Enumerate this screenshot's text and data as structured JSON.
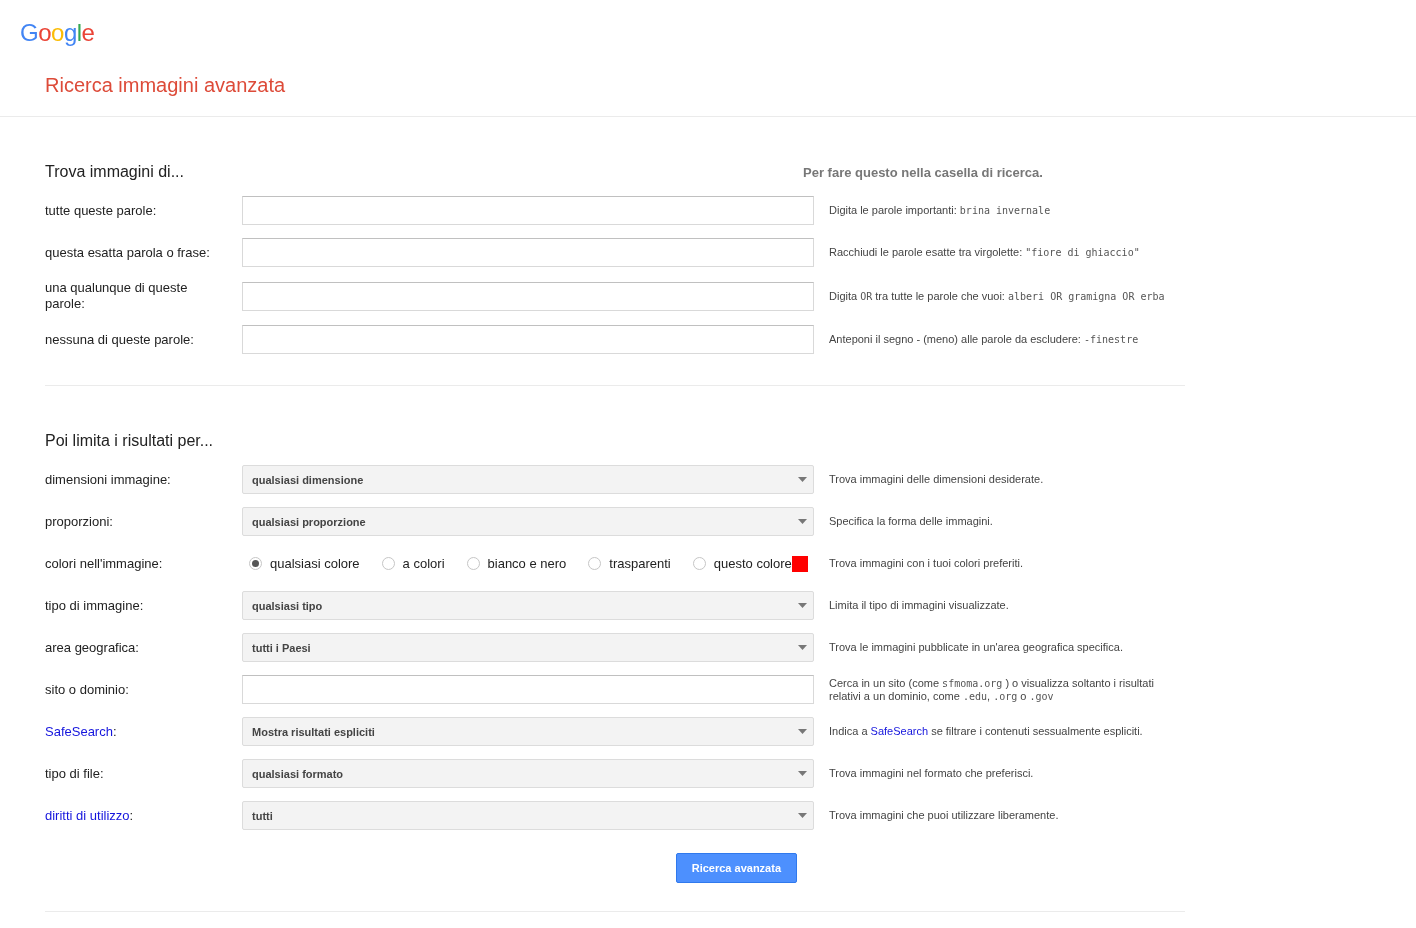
{
  "header": {
    "logo": "Google",
    "title": "Ricerca immagini avanzata"
  },
  "sections": [
    {
      "heading": "Trova immagini di...",
      "aside_heading": "Per fare questo nella casella di ricerca.",
      "rows": [
        {
          "kind": "text",
          "label": [
            {
              "kind": "plain",
              "text": "tutte queste parole:"
            }
          ],
          "value": "",
          "hint": [
            {
              "kind": "plain",
              "text": "Digita le parole importanti: "
            },
            {
              "kind": "code",
              "text": "brina invernale"
            }
          ]
        },
        {
          "kind": "text",
          "label": [
            {
              "kind": "plain",
              "text": "questa esatta parola o frase:"
            }
          ],
          "value": "",
          "hint": [
            {
              "kind": "plain",
              "text": "Racchiudi le parole esatte tra virgolette: "
            },
            {
              "kind": "code",
              "text": "\"fiore di ghiaccio\""
            }
          ]
        },
        {
          "kind": "text",
          "label": [
            {
              "kind": "plain",
              "text": "una qualunque di queste parole:"
            }
          ],
          "value": "",
          "hint": [
            {
              "kind": "plain",
              "text": "Digita "
            },
            {
              "kind": "code",
              "text": "OR"
            },
            {
              "kind": "plain",
              "text": " tra tutte le parole che vuoi: "
            },
            {
              "kind": "code",
              "text": "alberi OR gramigna OR erba"
            }
          ]
        },
        {
          "kind": "text",
          "label": [
            {
              "kind": "plain",
              "text": "nessuna di queste parole:"
            }
          ],
          "value": "",
          "hint": [
            {
              "kind": "plain",
              "text": "Anteponi il segno - (meno) alle parole da escludere: "
            },
            {
              "kind": "code",
              "text": "-finestre"
            }
          ]
        }
      ]
    },
    {
      "heading": "Poi limita i risultati per...",
      "rows": [
        {
          "kind": "select",
          "label": [
            {
              "kind": "plain",
              "text": "dimensioni immagine:"
            }
          ],
          "value": "qualsiasi dimensione",
          "hint": [
            {
              "kind": "plain",
              "text": "Trova immagini delle dimensioni desiderate."
            }
          ]
        },
        {
          "kind": "select",
          "label": [
            {
              "kind": "plain",
              "text": "proporzioni:"
            }
          ],
          "value": "qualsiasi proporzione",
          "hint": [
            {
              "kind": "plain",
              "text": "Specifica la forma delle immagini."
            }
          ]
        },
        {
          "kind": "colors",
          "label": [
            {
              "kind": "plain",
              "text": "colori nell'immagine:"
            }
          ],
          "options": [
            {
              "label": "qualsiasi colore",
              "selected": true
            },
            {
              "label": "a colori",
              "selected": false
            },
            {
              "label": "bianco e nero",
              "selected": false
            },
            {
              "label": "trasparenti",
              "selected": false
            },
            {
              "label": "questo colore",
              "selected": false,
              "color": "#ff0000"
            }
          ],
          "hint": [
            {
              "kind": "plain",
              "text": "Trova immagini con i tuoi colori preferiti."
            }
          ]
        },
        {
          "kind": "select",
          "label": [
            {
              "kind": "plain",
              "text": "tipo di immagine:"
            }
          ],
          "value": "qualsiasi tipo",
          "hint": [
            {
              "kind": "plain",
              "text": "Limita il tipo di immagini visualizzate."
            }
          ]
        },
        {
          "kind": "select",
          "label": [
            {
              "kind": "plain",
              "text": "area geografica:"
            }
          ],
          "value": "tutti i Paesi",
          "hint": [
            {
              "kind": "plain",
              "text": "Trova le immagini pubblicate in un'area geografica specifica."
            }
          ]
        },
        {
          "kind": "text",
          "label": [
            {
              "kind": "plain",
              "text": "sito o dominio:"
            }
          ],
          "value": "",
          "hint": [
            {
              "kind": "plain",
              "text": "Cerca in un sito (come "
            },
            {
              "kind": "code",
              "text": "sfmoma.org"
            },
            {
              "kind": "plain",
              "text": " ) o visualizza soltanto i risultati relativi a un dominio, come "
            },
            {
              "kind": "code",
              "text": ".edu"
            },
            {
              "kind": "plain",
              "text": ", "
            },
            {
              "kind": "code",
              "text": ".org"
            },
            {
              "kind": "plain",
              "text": " o "
            },
            {
              "kind": "code",
              "text": ".gov"
            }
          ]
        },
        {
          "kind": "select",
          "label": [
            {
              "kind": "link",
              "text": "SafeSearch"
            },
            {
              "kind": "plain",
              "text": ":"
            }
          ],
          "value": "Mostra risultati espliciti",
          "hint": [
            {
              "kind": "plain",
              "text": "Indica a "
            },
            {
              "kind": "link",
              "text": "SafeSearch"
            },
            {
              "kind": "plain",
              "text": " se filtrare i contenuti sessualmente espliciti."
            }
          ]
        },
        {
          "kind": "select",
          "label": [
            {
              "kind": "plain",
              "text": "tipo di file:"
            }
          ],
          "value": "qualsiasi formato",
          "hint": [
            {
              "kind": "plain",
              "text": "Trova immagini nel formato che preferisci."
            }
          ]
        },
        {
          "kind": "select",
          "label": [
            {
              "kind": "link",
              "text": "diritti di utilizzo"
            },
            {
              "kind": "plain",
              "text": ":"
            }
          ],
          "value": "tutti",
          "hint": [
            {
              "kind": "plain",
              "text": "Trova immagini che puoi utilizzare liberamente."
            }
          ]
        }
      ]
    }
  ],
  "submit": "Ricerca avanzata"
}
